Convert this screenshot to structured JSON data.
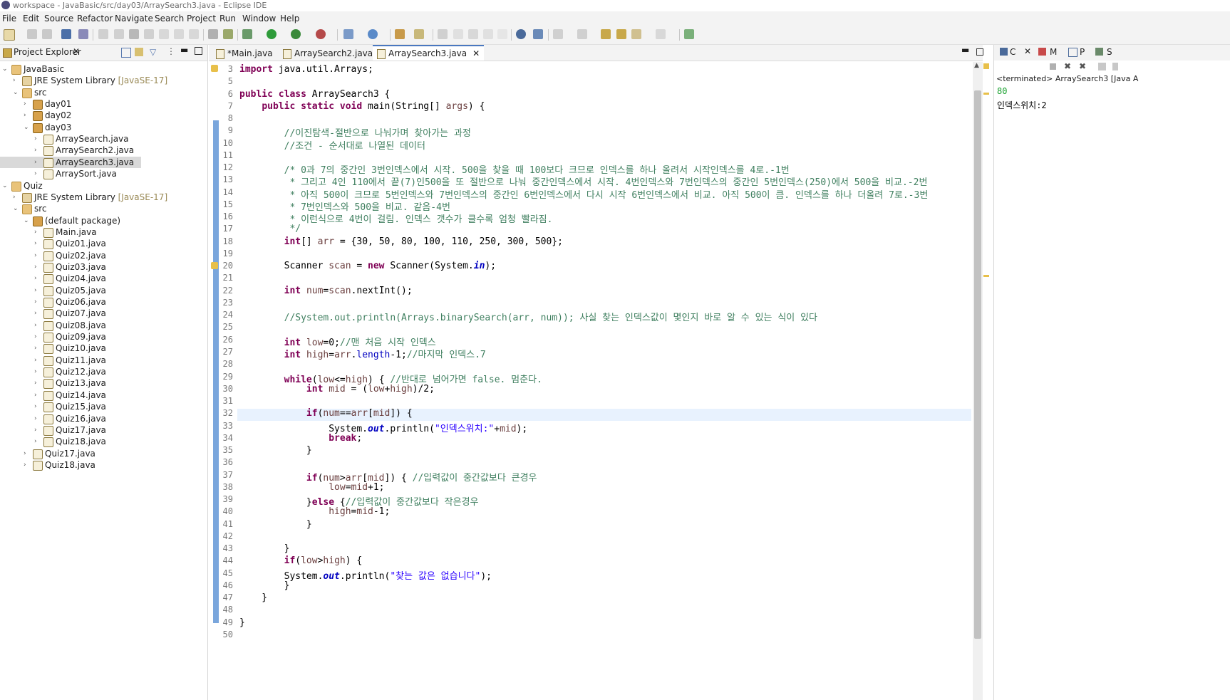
{
  "window": {
    "title": "workspace - JavaBasic/src/day03/ArraySearch3.java - Eclipse IDE"
  },
  "menu": [
    "File",
    "Edit",
    "Source",
    "Refactor",
    "Navigate",
    "Search",
    "Project",
    "Run",
    "Window",
    "Help"
  ],
  "project_explorer": {
    "title": "Project Explorer",
    "tree": [
      {
        "label": "JavaBasic",
        "icon": "project-icon",
        "twisty": "open",
        "indent": 0
      },
      {
        "label": "JRE System Library",
        "suffix": "[JavaSE-17]",
        "icon": "library-icon",
        "twisty": "closed",
        "indent": 1
      },
      {
        "label": "src",
        "icon": "source-folder-icon",
        "twisty": "open",
        "indent": 1
      },
      {
        "label": "day01",
        "icon": "package-icon",
        "twisty": "closed",
        "indent": 2
      },
      {
        "label": "day02",
        "icon": "package-icon",
        "twisty": "closed",
        "indent": 2
      },
      {
        "label": "day03",
        "icon": "package-icon",
        "twisty": "open",
        "indent": 2
      },
      {
        "label": "ArraySearch.java",
        "icon": "java-file-icon",
        "twisty": "closed",
        "indent": 3
      },
      {
        "label": "ArraySearch2.java",
        "icon": "java-file-icon",
        "twisty": "closed",
        "indent": 3
      },
      {
        "label": "ArraySearch3.java",
        "icon": "java-file-icon",
        "twisty": "closed",
        "indent": 3,
        "selected": true
      },
      {
        "label": "ArraySort.java",
        "icon": "java-file-icon",
        "twisty": "closed",
        "indent": 3
      },
      {
        "label": "Quiz",
        "icon": "project-icon",
        "twisty": "open",
        "indent": 0
      },
      {
        "label": "JRE System Library",
        "suffix": "[JavaSE-17]",
        "icon": "library-icon",
        "twisty": "closed",
        "indent": 1
      },
      {
        "label": "src",
        "icon": "source-folder-icon",
        "twisty": "open",
        "indent": 1
      },
      {
        "label": "(default package)",
        "icon": "package-icon",
        "twisty": "open",
        "indent": 2
      },
      {
        "label": "Main.java",
        "icon": "java-file-icon",
        "twisty": "closed",
        "indent": 3
      },
      {
        "label": "Quiz01.java",
        "icon": "java-file-icon",
        "twisty": "closed",
        "indent": 3
      },
      {
        "label": "Quiz02.java",
        "icon": "java-file-icon",
        "twisty": "closed",
        "indent": 3
      },
      {
        "label": "Quiz03.java",
        "icon": "java-file-icon",
        "twisty": "closed",
        "indent": 3
      },
      {
        "label": "Quiz04.java",
        "icon": "java-file-icon",
        "twisty": "closed",
        "indent": 3
      },
      {
        "label": "Quiz05.java",
        "icon": "java-file-icon",
        "twisty": "closed",
        "indent": 3
      },
      {
        "label": "Quiz06.java",
        "icon": "java-file-icon",
        "twisty": "closed",
        "indent": 3
      },
      {
        "label": "Quiz07.java",
        "icon": "java-file-icon",
        "twisty": "closed",
        "indent": 3
      },
      {
        "label": "Quiz08.java",
        "icon": "java-file-icon",
        "twisty": "closed",
        "indent": 3
      },
      {
        "label": "Quiz09.java",
        "icon": "java-file-icon",
        "twisty": "closed",
        "indent": 3
      },
      {
        "label": "Quiz10.java",
        "icon": "java-file-icon",
        "twisty": "closed",
        "indent": 3
      },
      {
        "label": "Quiz11.java",
        "icon": "java-file-icon",
        "twisty": "closed",
        "indent": 3
      },
      {
        "label": "Quiz12.java",
        "icon": "java-file-icon",
        "twisty": "closed",
        "indent": 3
      },
      {
        "label": "Quiz13.java",
        "icon": "java-file-icon",
        "twisty": "closed",
        "indent": 3
      },
      {
        "label": "Quiz14.java",
        "icon": "java-file-icon",
        "twisty": "closed",
        "indent": 3
      },
      {
        "label": "Quiz15.java",
        "icon": "java-file-icon",
        "twisty": "closed",
        "indent": 3
      },
      {
        "label": "Quiz16.java",
        "icon": "java-file-icon",
        "twisty": "closed",
        "indent": 3
      },
      {
        "label": "Quiz17.java",
        "icon": "java-file-icon",
        "twisty": "closed",
        "indent": 3
      },
      {
        "label": "Quiz18.java",
        "icon": "java-file-icon",
        "twisty": "closed",
        "indent": 3
      },
      {
        "label": "Quiz17.java",
        "icon": "java-file-icon",
        "twisty": "closed",
        "indent": 2
      },
      {
        "label": "Quiz18.java",
        "icon": "java-file-icon",
        "twisty": "closed",
        "indent": 2
      }
    ]
  },
  "editor": {
    "tabs": [
      {
        "label": "*Main.java",
        "active": false
      },
      {
        "label": "ArraySearch2.java",
        "active": false
      },
      {
        "label": "ArraySearch3.java",
        "active": true
      }
    ],
    "lines": [
      {
        "n": "3",
        "html": "<span class='kw'>import</span> java.util.Arrays;"
      },
      {
        "n": "5",
        "html": ""
      },
      {
        "n": "6",
        "html": "<span class='kw'>public class</span> ArraySearch3 {"
      },
      {
        "n": "7",
        "html": "    <span class='kw'>public static void</span> main(String[] <span class='var'>args</span>) {"
      },
      {
        "n": "8",
        "html": ""
      },
      {
        "n": "9",
        "html": "        <span class='cm'>//이진탐색-절반으로 나눠가며 찾아가는 과정</span>"
      },
      {
        "n": "10",
        "html": "        <span class='cm'>//조건 - 순서대로 나열된 데이터</span>"
      },
      {
        "n": "11",
        "html": ""
      },
      {
        "n": "12",
        "html": "        <span class='cm'>/* 0과 7의 중간인 3번인덱스에서 시작. 500을 찾을 때 100보다 크므로 인덱스를 하나 올려서 시작인덱스를 4로.-1번</span>"
      },
      {
        "n": "13",
        "html": "<span class='cm'>         * 그리고 4인 110에서 끝(7)인500을 또 절반으로 나눠 중간인덱스에서 시작. 4번인덱스와 7번인덱스의 중간인 5번인덱스(250)에서 500을 비교.-2번</span>"
      },
      {
        "n": "14",
        "html": "<span class='cm'>         * 아직 500이 크므로 5번인덱스와 7번인덱스의 중간인 6번인덱스에서 다시 시작 6번인덱스에서 비교. 아직 500이 큼. 인덱스를 하나 더올려 7로.-3번</span>"
      },
      {
        "n": "15",
        "html": "<span class='cm'>         * 7번인덱스와 500을 비교. 같음-4번</span>"
      },
      {
        "n": "16",
        "html": "<span class='cm'>         * 이런식으로 4번이 걸림. 인덱스 갯수가 클수록 엄청 빨라짐.</span>"
      },
      {
        "n": "17",
        "html": "<span class='cm'>         */</span>"
      },
      {
        "n": "18",
        "html": "        <span class='kw'>int</span>[] <span class='var'>arr</span> = {30, 50, 80, 100, 110, 250, 300, 500};"
      },
      {
        "n": "19",
        "html": ""
      },
      {
        "n": "20",
        "html": "        Scanner <span class='var'>scan</span> = <span class='kw'>new</span> Scanner(System.<span class='fld'>in</span>);"
      },
      {
        "n": "21",
        "html": ""
      },
      {
        "n": "22",
        "html": "        <span class='kw'>int</span> <span class='var'>num</span>=<span class='var'>scan</span>.nextInt();"
      },
      {
        "n": "23",
        "html": ""
      },
      {
        "n": "24",
        "html": "        <span class='cm'>//System.out.println(Arrays.binarySearch(arr, num)); 사실 찾는 인덱스값이 몇인지 바로 알 수 있는 식이 있다</span>"
      },
      {
        "n": "25",
        "html": ""
      },
      {
        "n": "26",
        "html": "        <span class='kw'>int</span> <span class='var'>low</span>=0;<span class='cm'>//맨 처음 시작 인덱스</span>"
      },
      {
        "n": "27",
        "html": "        <span class='kw'>int</span> <span class='var'>high</span>=<span class='var'>arr</span>.<span class='str' style='color:#0000c0'>length</span>-1;<span class='cm'>//마지막 인덱스.7</span>"
      },
      {
        "n": "28",
        "html": ""
      },
      {
        "n": "29",
        "html": "        <span class='kw'>while</span>(<span class='var'>low</span>&lt;=<span class='var'>high</span>) { <span class='cm'>//반대로 넘어가면 false. 멈춘다.</span>"
      },
      {
        "n": "30",
        "html": "            <span class='kw'>int</span> <span class='var'>mid</span> = (<span class='var'>low</span>+<span class='var'>high</span>)/2;"
      },
      {
        "n": "31",
        "html": ""
      },
      {
        "n": "32",
        "html": "            <span class='kw'>if</span>(<span class='var'>num</span>==<span class='var'>arr</span>[<span class='var'>mid</span>]) {"
      },
      {
        "n": "33",
        "html": "                System.<span class='fld'>out</span>.println(<span class='str'>\"인덱스위치:\"</span>+<span class='var'>mid</span>);"
      },
      {
        "n": "34",
        "html": "                <span class='kw'>break</span>;"
      },
      {
        "n": "35",
        "html": "            }"
      },
      {
        "n": "36",
        "html": ""
      },
      {
        "n": "37",
        "html": "            <span class='kw'>if</span>(<span class='var'>num</span>&gt;<span class='var'>arr</span>[<span class='var'>mid</span>]) { <span class='cm'>//입력값이 중간값보다 큰경우</span>"
      },
      {
        "n": "38",
        "html": "                <span class='var'>low</span>=<span class='var'>mid</span>+1;"
      },
      {
        "n": "39",
        "html": "            }<span class='kw'>else</span> {<span class='cm'>//입력값이 중간값보다 작은경우</span>"
      },
      {
        "n": "40",
        "html": "                <span class='var'>high</span>=<span class='var'>mid</span>-1;"
      },
      {
        "n": "41",
        "html": "            }"
      },
      {
        "n": "42",
        "html": ""
      },
      {
        "n": "43",
        "html": "        }"
      },
      {
        "n": "44",
        "html": "        <span class='kw'>if</span>(<span class='var'>low</span>&gt;<span class='var'>high</span>) {"
      },
      {
        "n": "45",
        "html": "        System.<span class='fld'>out</span>.println(<span class='str'>\"찾는 값은 없습니다\"</span>);"
      },
      {
        "n": "46",
        "html": "        }"
      },
      {
        "n": "47",
        "html": "    }"
      },
      {
        "n": "48",
        "html": ""
      },
      {
        "n": "49",
        "html": "}"
      },
      {
        "n": "50",
        "html": ""
      }
    ]
  },
  "console": {
    "tabs": [
      "C",
      "M",
      "P",
      "S"
    ],
    "header": "<terminated> ArraySearch3 [Java A",
    "input_line": "80",
    "output_line": "인덱스위치:2"
  }
}
